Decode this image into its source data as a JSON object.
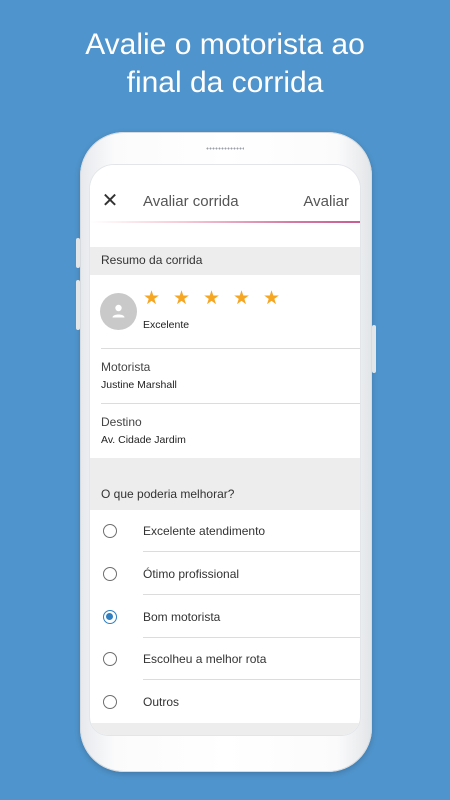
{
  "headline": "Avalie o motorista ao\nfinal da corrida",
  "topbar": {
    "close_icon": "close-icon",
    "title": "Avaliar corrida",
    "action_label": "Avaliar"
  },
  "summary": {
    "header": "Resumo da corrida",
    "avatar_icon": "person-icon",
    "rating": {
      "stars": 5,
      "max": 5,
      "label": "Excelente"
    },
    "driver_label": "Motorista",
    "driver_name": "Justine Marshall",
    "destination_label": "Destino",
    "destination_value": "Av. Cidade Jardim"
  },
  "improve": {
    "header": "O que poderia melhorar?",
    "options": [
      {
        "label": "Excelente atendimento",
        "selected": false
      },
      {
        "label": "Ótimo profissional",
        "selected": false
      },
      {
        "label": "Bom motorista",
        "selected": true
      },
      {
        "label": "Escolheu a melhor rota",
        "selected": false
      },
      {
        "label": "Outros",
        "selected": false
      }
    ]
  },
  "colors": {
    "background": "#4f94cc",
    "star": "#f5a623",
    "radio_selected": "#2f7fc1",
    "section_bg": "#ededed"
  }
}
